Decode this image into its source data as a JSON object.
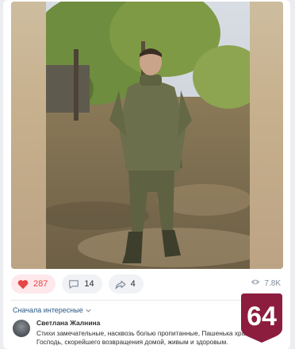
{
  "post": {
    "actions": {
      "likes": "287",
      "comments": "14",
      "shares": "4"
    },
    "views": "7.8K"
  },
  "comments_section": {
    "sort_label": "Сначала интересные"
  },
  "comment": {
    "author": "Светлана Жалнина",
    "text": "Стихи замечательные, насквозь болью пропитанные, Пашенька храни тебя Господь, скорейшего возвращения домой, живым и здоровым."
  },
  "logo": {
    "text": "64",
    "color": "#8c1d3f"
  },
  "colors": {
    "like_active": "#e64646",
    "link": "#2a5885",
    "muted": "#818c99"
  },
  "icons": [
    "heart-icon",
    "comment-icon",
    "share-icon",
    "eye-icon",
    "chevron-down-icon"
  ]
}
